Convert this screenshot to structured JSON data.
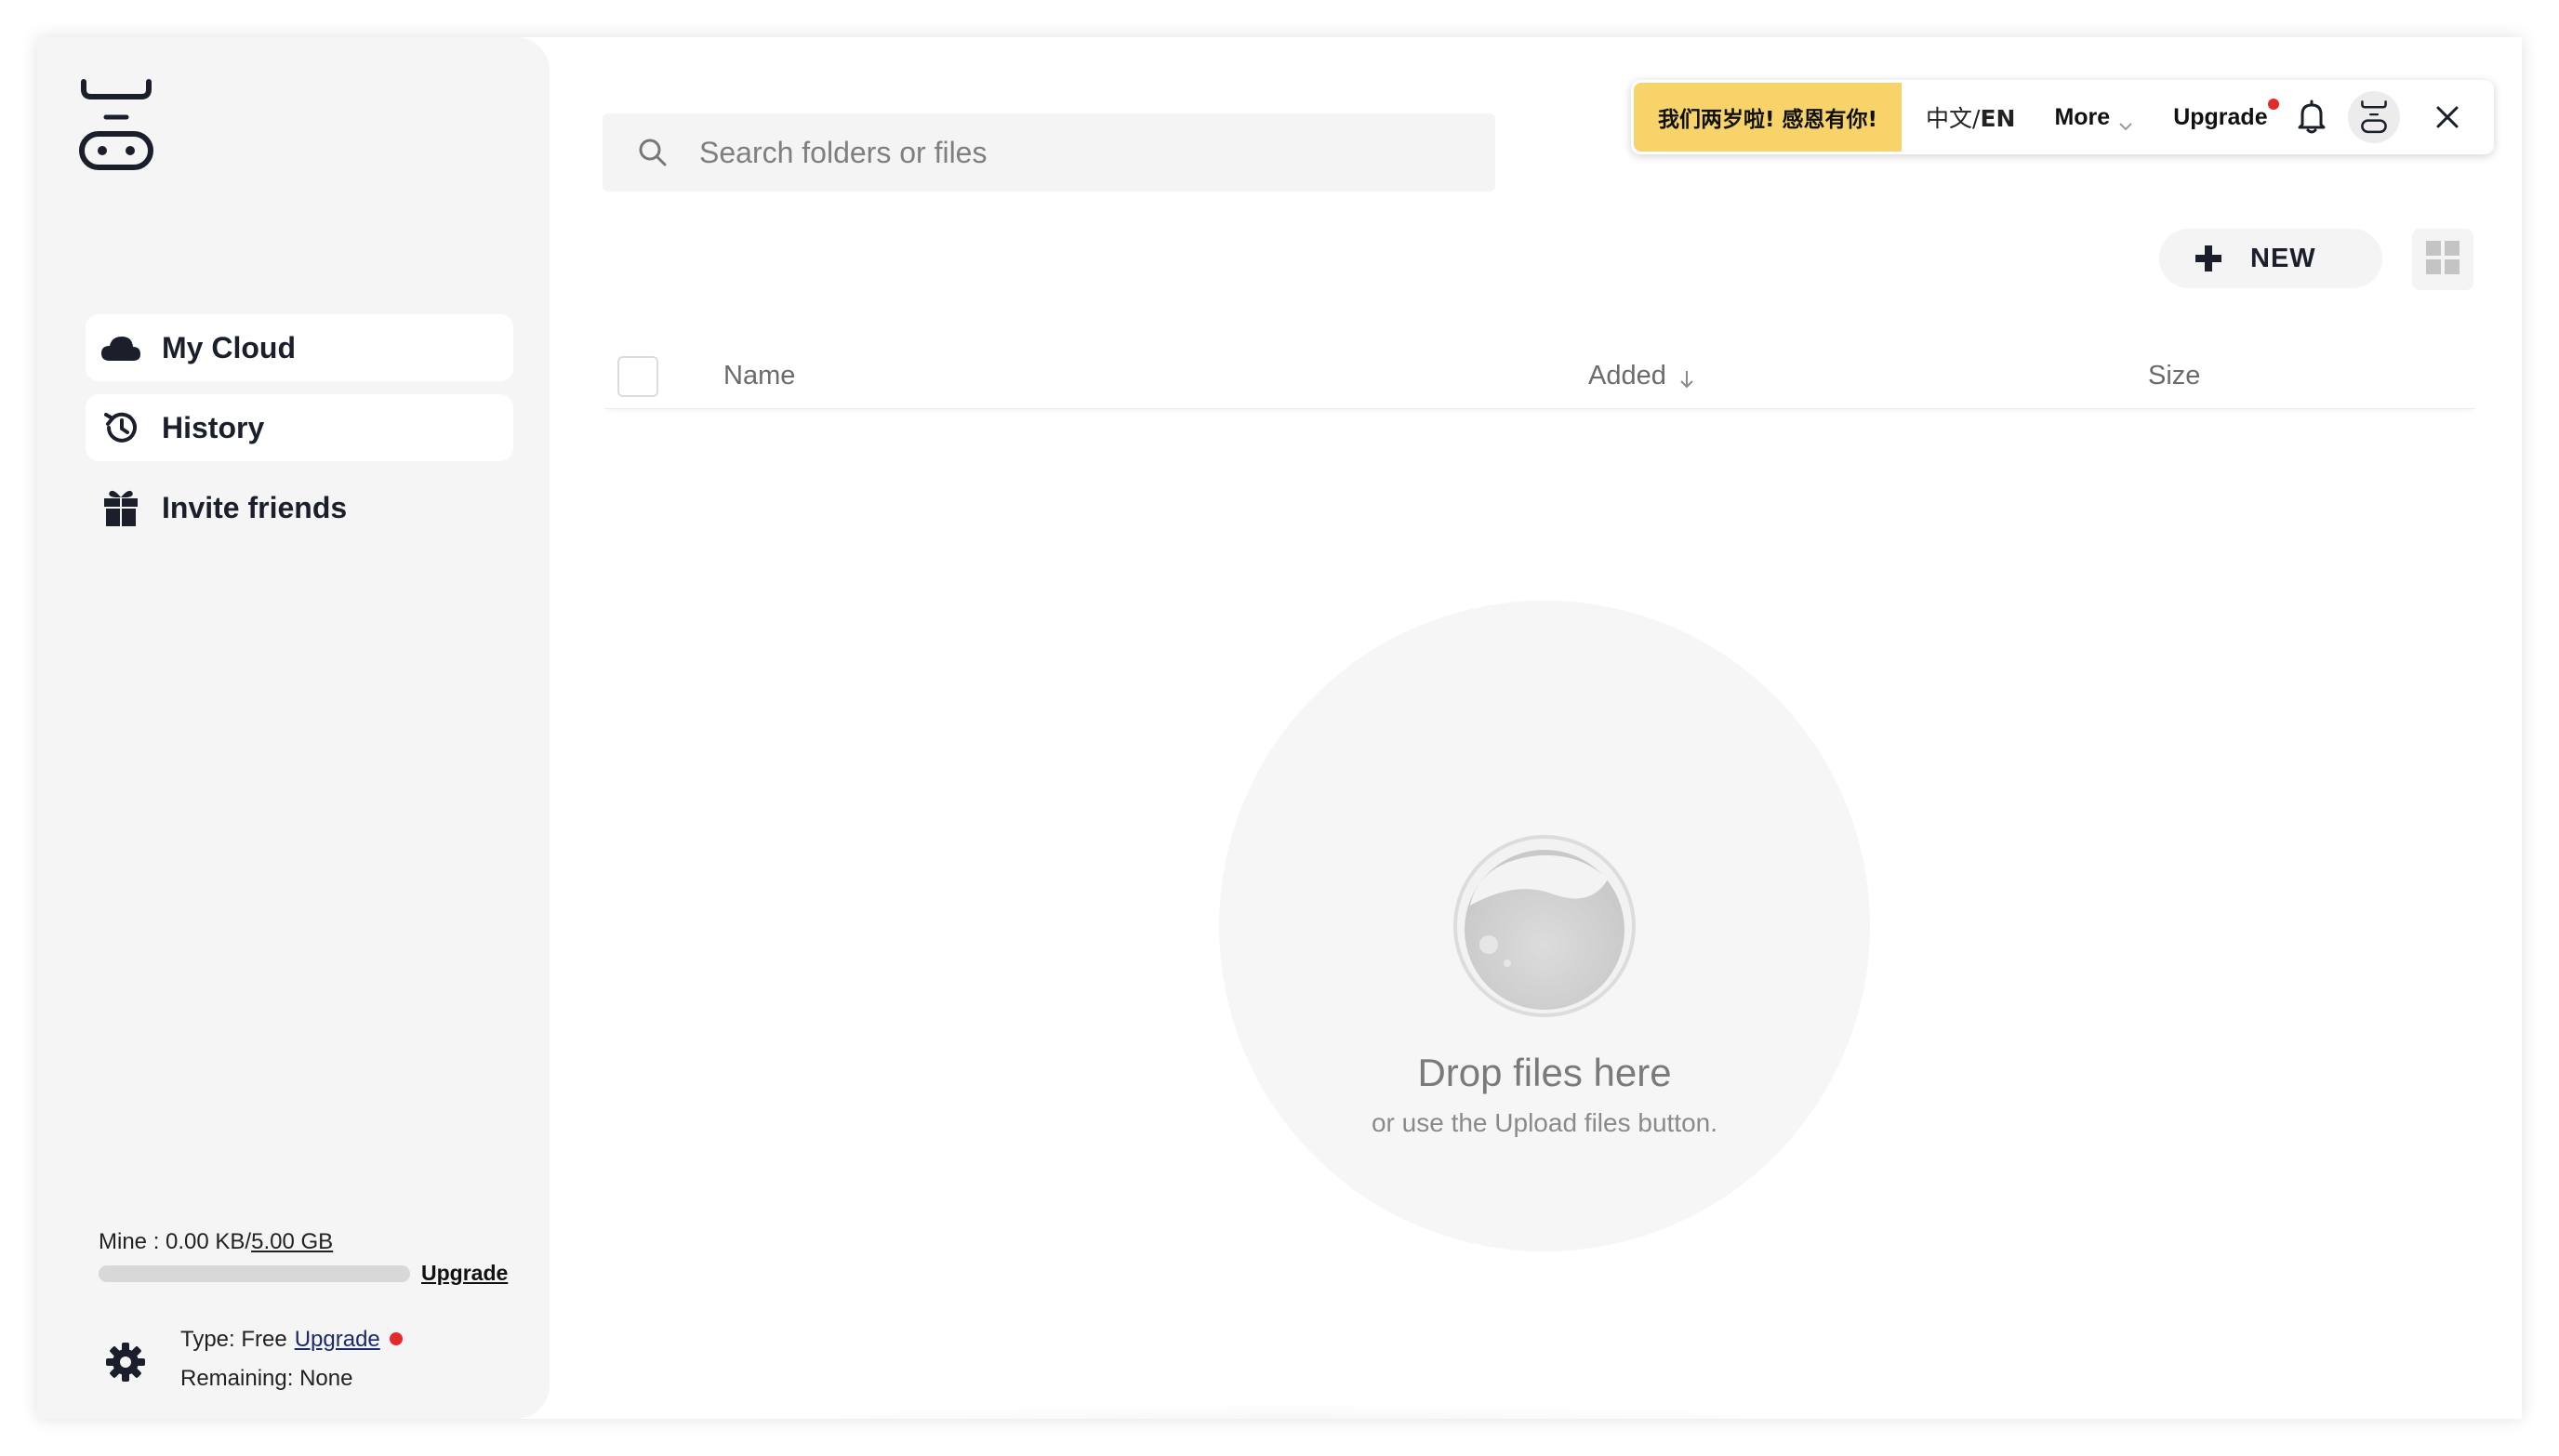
{
  "sidebar": {
    "items": [
      {
        "label": "My Cloud",
        "icon": "cloud-icon",
        "active": true
      },
      {
        "label": "History",
        "icon": "history-icon",
        "active": true
      },
      {
        "label": "Invite friends",
        "icon": "gift-icon",
        "active": false
      }
    ],
    "storage": {
      "prefix": "Mine : 0.00 KB/",
      "total": "5.00 GB",
      "used_fraction": 0,
      "upgrade_label": "Upgrade"
    },
    "plan": {
      "type_label": "Type: Free",
      "upgrade_label": "Upgrade",
      "remaining_label": "Remaining: None"
    }
  },
  "search": {
    "placeholder": "Search folders or files",
    "value": ""
  },
  "topbar": {
    "promo": "我们两岁啦! 感恩有你!",
    "lang_prefix": "中文/",
    "lang_active": "EN",
    "more_label": "More",
    "upgrade_label": "Upgrade",
    "promo_color": "#f7d36a",
    "badge_color": "#e52a2a"
  },
  "toolbar": {
    "new_label": "NEW"
  },
  "table": {
    "columns": [
      "Name",
      "Added",
      "Size"
    ],
    "sort_column": "Added",
    "sort_direction": "descending"
  },
  "empty_state": {
    "title": "Drop files here",
    "subtitle": "or use the Upload files button."
  }
}
